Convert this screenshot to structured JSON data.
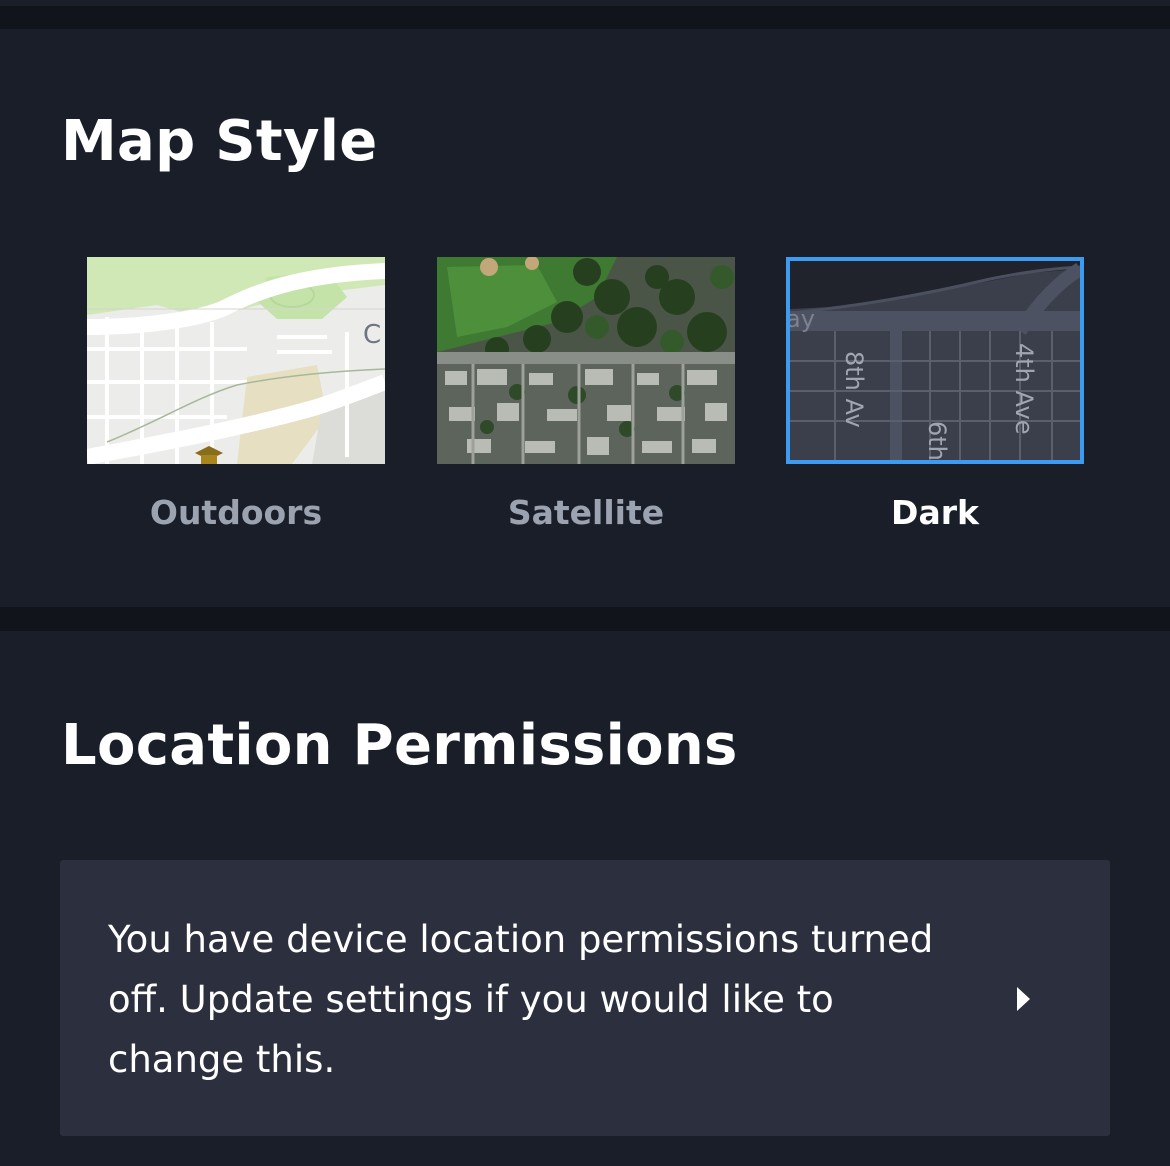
{
  "map_style": {
    "title": "Map Style",
    "options": [
      {
        "id": "outdoors",
        "label": "Outdoors",
        "selected": false,
        "thumbnail_labels": [
          "C"
        ]
      },
      {
        "id": "satellite",
        "label": "Satellite",
        "selected": false
      },
      {
        "id": "dark",
        "label": "Dark",
        "selected": true,
        "thumbnail_labels": [
          "ay",
          "8th Av",
          "6th",
          "4th Ave"
        ]
      }
    ],
    "selected_border_color": "#3d9bf0"
  },
  "location_permissions": {
    "title": "Location Permissions",
    "message": "You have device location permissions turned off. Update settings if you would like to change this.",
    "action_icon": "chevron-right-icon"
  },
  "colors": {
    "background": "#11141b",
    "section": "#1a1e29",
    "card": "#2c303e",
    "text_primary": "#ffffff",
    "text_muted": "#9ca3b0",
    "accent": "#3d9bf0"
  }
}
